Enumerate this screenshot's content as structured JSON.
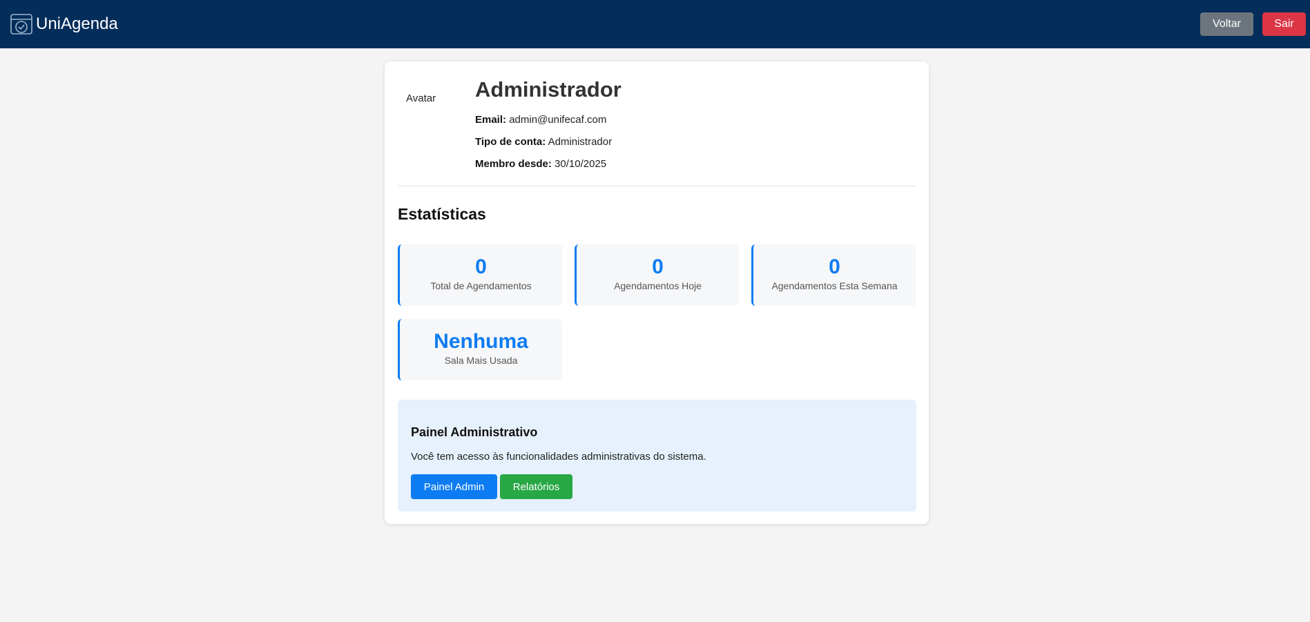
{
  "header": {
    "brand_name": "UniAgenda",
    "back_label": "Voltar",
    "logout_label": "Sair"
  },
  "profile": {
    "avatar_alt": "Avatar",
    "name": "Administrador",
    "email_label": "Email:",
    "email": "admin@unifecaf.com",
    "account_type_label": "Tipo de conta:",
    "account_type": "Administrador",
    "member_since_label": "Membro desde:",
    "member_since": "30/10/2025"
  },
  "stats": {
    "title": "Estatísticas",
    "items": [
      {
        "value": "0",
        "label": "Total de Agendamentos"
      },
      {
        "value": "0",
        "label": "Agendamentos Hoje"
      },
      {
        "value": "0",
        "label": "Agendamentos Esta Semana"
      },
      {
        "value": "Nenhuma",
        "label": "Sala Mais Usada"
      }
    ]
  },
  "admin_panel": {
    "title": "Painel Administrativo",
    "description": "Você tem acesso às funcionalidades administrativas do sistema.",
    "admin_button_label": "Painel Admin",
    "reports_button_label": "Relatórios"
  },
  "colors": {
    "header_bg": "#032d5a",
    "accent": "#0d7cf2",
    "back_button": "#6c757d",
    "logout_button": "#dc3545",
    "reports_button": "#28a745",
    "admin_panel_bg": "#e6f1fd"
  },
  "icons": {
    "brand": "calendar-check-icon"
  }
}
